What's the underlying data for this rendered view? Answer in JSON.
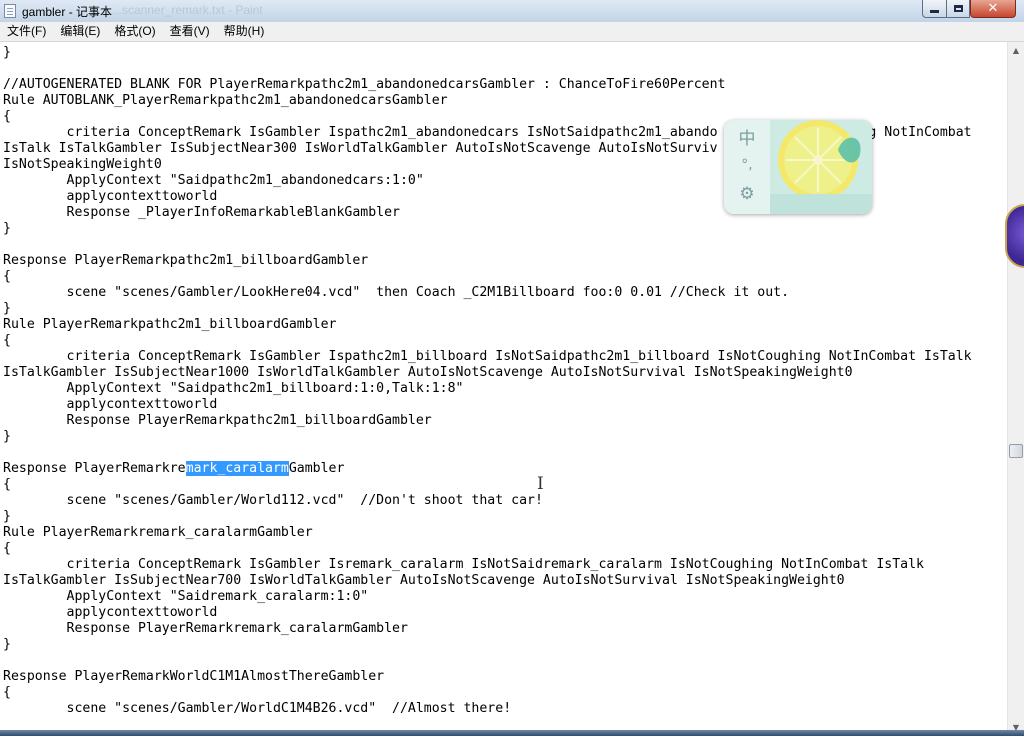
{
  "window": {
    "title": "gambler - 记事本",
    "ghost_title": "...scanner_remark.txt - Paint"
  },
  "menu": {
    "items": [
      "文件(F)",
      "编辑(E)",
      "格式(O)",
      "查看(V)",
      "帮助(H)"
    ]
  },
  "editor": {
    "lines": [
      "}",
      "",
      "//AUTOGENERATED BLANK FOR PlayerRemarkpathc2m1_abandonedcarsGambler : ChanceToFire60Percent",
      "Rule AUTOBLANK_PlayerRemarkpathc2m1_abandonedcarsGambler",
      "{",
      "\tcriteria ConceptRemark IsGambler Ispathc2m1_abandonedcars IsNotSaidpathc2m1_abando                  ng NotInCombat",
      "IsTalk IsTalkGambler IsSubjectNear300 IsWorldTalkGambler AutoIsNotScavenge AutoIsNotSurviv               ght0",
      "IsNotSpeakingWeight0",
      "\tApplyContext \"Saidpathc2m1_abandonedcars:1:0\"",
      "\tapplycontexttoworld",
      "\tResponse _PlayerInfoRemarkableBlankGambler",
      "}",
      "",
      "Response PlayerRemarkpathc2m1_billboardGambler",
      "{",
      "\tscene \"scenes/Gambler/LookHere04.vcd\"  then Coach _C2M1Billboard foo:0 0.01 //Check it out.",
      "}",
      "Rule PlayerRemarkpathc2m1_billboardGambler",
      "{",
      "\tcriteria ConceptRemark IsGambler Ispathc2m1_billboard IsNotSaidpathc2m1_billboard IsNotCoughing NotInCombat IsTalk",
      "IsTalkGambler IsSubjectNear1000 IsWorldTalkGambler AutoIsNotScavenge AutoIsNotSurvival IsNotSpeakingWeight0",
      "\tApplyContext \"Saidpathc2m1_billboard:1:0,Talk:1:8\"",
      "\tapplycontexttoworld",
      "\tResponse PlayerRemarkpathc2m1_billboardGambler",
      "}",
      "",
      "Response PlayerRemarkremark_caralarmGambler",
      "{",
      "\tscene \"scenes/Gambler/World112.vcd\"  //Don't shoot that car!",
      "}",
      "Rule PlayerRemarkremark_caralarmGambler",
      "{",
      "\tcriteria ConceptRemark IsGambler Isremark_caralarm IsNotSaidremark_caralarm IsNotCoughing NotInCombat IsTalk",
      "IsTalkGambler IsSubjectNear700 IsWorldTalkGambler AutoIsNotScavenge AutoIsNotSurvival IsNotSpeakingWeight0",
      "\tApplyContext \"Saidremark_caralarm:1:0\"",
      "\tapplycontexttoworld",
      "\tResponse PlayerRemarkremark_caralarmGambler",
      "}",
      "",
      "Response PlayerRemarkWorldC1M1AlmostThereGambler",
      "{",
      "\tscene \"scenes/Gambler/WorldC1M4B26.vcd\"  //Almost there!"
    ],
    "selection": {
      "line": 26,
      "before": "Response PlayerRemarkre",
      "selected": "mark_caralarm",
      "after": "Gambler"
    }
  },
  "ime": {
    "mode_label": "中",
    "punct_label": "°,"
  },
  "colors": {
    "selection": "#3399ff",
    "titlebar": "#c3d4e7",
    "close_button": "#c7452d"
  }
}
